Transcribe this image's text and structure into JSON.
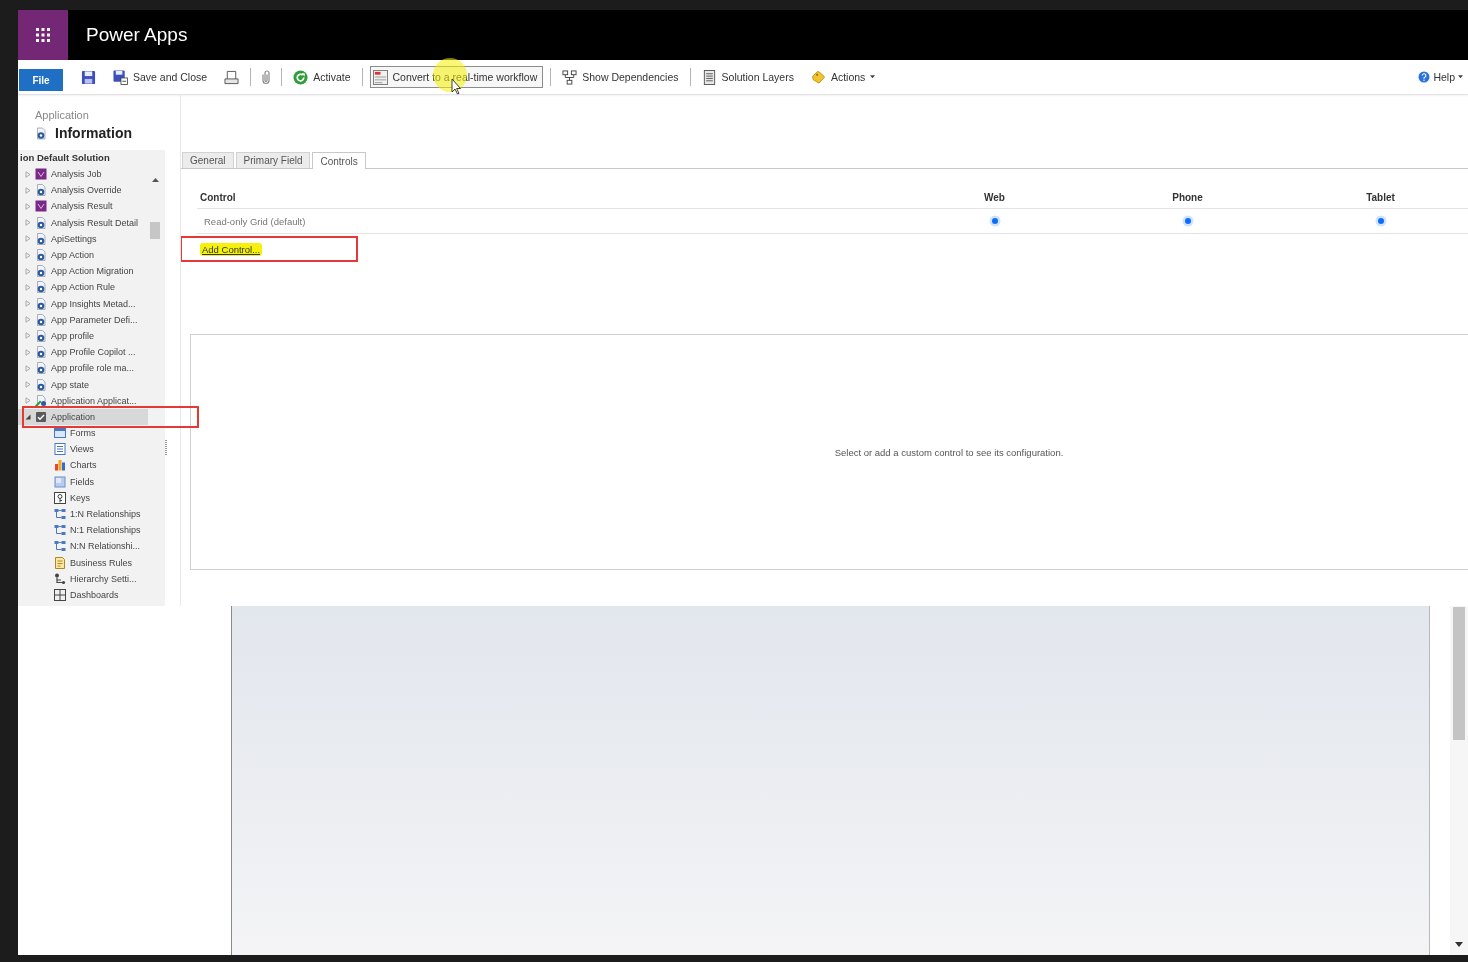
{
  "app_bar": {
    "title": "Power Apps"
  },
  "toolbar": {
    "file": "File",
    "groups": [
      [
        {
          "kind": "save",
          "hovered": false
        },
        {
          "kind": "saveclose",
          "label": "Save and Close",
          "hovered": false
        },
        {
          "kind": "print",
          "hovered": false
        }
      ],
      [
        {
          "kind": "attach",
          "hovered": false
        }
      ],
      [
        {
          "kind": "activate",
          "label": "Activate",
          "hovered": false
        }
      ],
      [
        {
          "kind": "convert",
          "label": "Convert to a real-time workflow",
          "hovered": true
        }
      ],
      [
        {
          "kind": "dependencies",
          "label": "Show Dependencies",
          "hovered": false
        }
      ],
      [
        {
          "kind": "layers",
          "label": "Solution Layers",
          "hovered": false
        },
        {
          "kind": "actions",
          "label": "Actions",
          "hovered": false
        }
      ]
    ],
    "help": "Help"
  },
  "form_header": {
    "entity": "Application",
    "title": "Information"
  },
  "sidebar": {
    "solution": "ion Default Solution",
    "tree": [
      {
        "label": "Analysis Job",
        "kind": "custom",
        "expanded": false,
        "selected": false,
        "annotated": false
      },
      {
        "label": "Analysis Override",
        "kind": "entity",
        "expanded": false,
        "selected": false,
        "annotated": false
      },
      {
        "label": "Analysis Result",
        "kind": "custom",
        "expanded": false,
        "selected": false,
        "annotated": false
      },
      {
        "label": "Analysis Result Detail",
        "kind": "entity",
        "expanded": false,
        "selected": false,
        "annotated": false
      },
      {
        "label": "ApiSettings",
        "kind": "entity",
        "expanded": false,
        "selected": false,
        "annotated": false
      },
      {
        "label": "App Action",
        "kind": "entity",
        "expanded": false,
        "selected": false,
        "annotated": false
      },
      {
        "label": "App Action Migration",
        "kind": "entity",
        "expanded": false,
        "selected": false,
        "annotated": false
      },
      {
        "label": "App Action Rule",
        "kind": "entity",
        "expanded": false,
        "selected": false,
        "annotated": false
      },
      {
        "label": "App Insights Metad...",
        "kind": "entity",
        "expanded": false,
        "selected": false,
        "annotated": false
      },
      {
        "label": "App Parameter Defi...",
        "kind": "entity",
        "expanded": false,
        "selected": false,
        "annotated": false
      },
      {
        "label": "App profile",
        "kind": "entity",
        "expanded": false,
        "selected": false,
        "annotated": false
      },
      {
        "label": "App Profile Copilot ...",
        "kind": "entity",
        "expanded": false,
        "selected": false,
        "annotated": false
      },
      {
        "label": "App profile role ma...",
        "kind": "entity",
        "expanded": false,
        "selected": false,
        "annotated": false
      },
      {
        "label": "App state",
        "kind": "entity",
        "expanded": false,
        "selected": false,
        "annotated": false
      },
      {
        "label": "Application Applicat...",
        "kind": "linked",
        "expanded": false,
        "selected": false,
        "annotated": false
      },
      {
        "label": "Application",
        "kind": "app",
        "expanded": true,
        "selected": true,
        "annotated": true,
        "children": [
          {
            "label": "Forms",
            "kind": "forms",
            "selected": false
          },
          {
            "label": "Views",
            "kind": "views",
            "selected": false
          },
          {
            "label": "Charts",
            "kind": "charts",
            "selected": false
          },
          {
            "label": "Fields",
            "kind": "fields",
            "selected": false
          },
          {
            "label": "Keys",
            "kind": "keys",
            "selected": false
          },
          {
            "label": "1:N Relationships",
            "kind": "relationship",
            "selected": false
          },
          {
            "label": "N:1 Relationships",
            "kind": "relationship",
            "selected": false
          },
          {
            "label": "N:N Relationshi...",
            "kind": "relationship",
            "selected": false
          },
          {
            "label": "Business Rules",
            "kind": "rules",
            "selected": false
          },
          {
            "label": "Hierarchy Setti...",
            "kind": "hierarchy",
            "selected": false
          },
          {
            "label": "Dashboards",
            "kind": "dashboards",
            "selected": false
          }
        ]
      }
    ]
  },
  "tabs": [
    {
      "label": "General",
      "selected": false
    },
    {
      "label": "Primary Field",
      "selected": false
    },
    {
      "label": "Controls",
      "selected": true
    }
  ],
  "controls": {
    "columns": [
      "Control",
      "Web",
      "Phone",
      "Tablet"
    ],
    "rows": [
      {
        "name": "Read-only Grid (default)",
        "targets": [
          {
            "selected": true
          },
          {
            "selected": true
          },
          {
            "selected": true
          }
        ]
      }
    ],
    "add_control": {
      "label": "Add Control...",
      "annotated": true
    }
  },
  "configuration": {
    "message": "Select or add a custom control to see its configuration."
  }
}
